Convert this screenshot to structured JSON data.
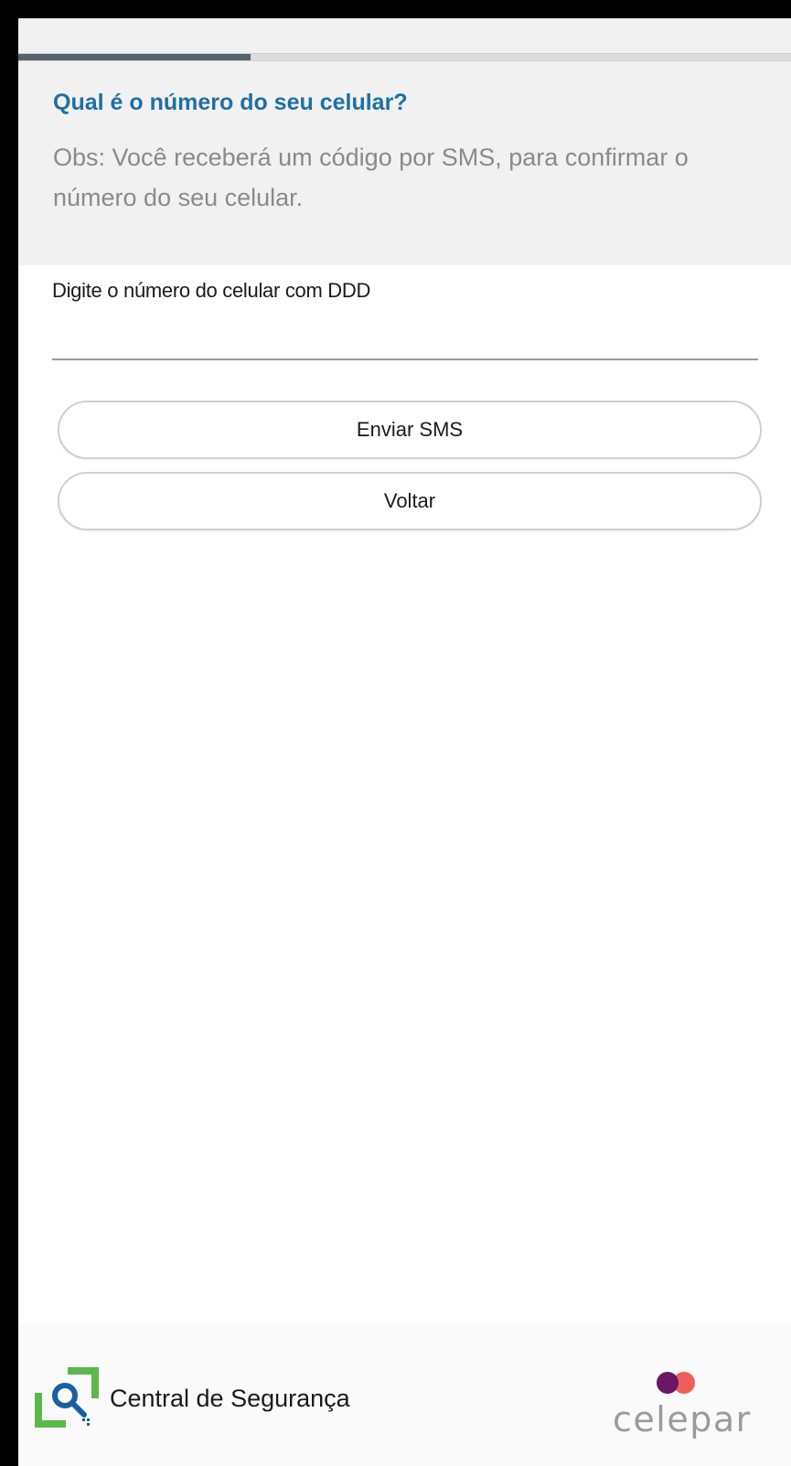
{
  "progress": {
    "fraction": 0.3
  },
  "header": {
    "title": "Qual é o número do seu celular?",
    "note": "Obs: Você receberá um código por SMS, para confirmar o número do seu celular."
  },
  "form": {
    "phone_label": "Digite o número do celular com DDD",
    "phone_value": "",
    "send_label": "Enviar SMS",
    "back_label": "Voltar"
  },
  "footer": {
    "app_name": "Central de Segurança",
    "brand": "celepar",
    "logo_icon": "magnifier-key-icon",
    "brand_icon": "two-dots-icon"
  },
  "colors": {
    "accent": "#1f6fa3",
    "progress": "#56636d",
    "logo_green": "#5db84a",
    "logo_blue": "#1b5fa0",
    "brand_purple": "#6a1766",
    "brand_coral": "#ef5f5a"
  }
}
